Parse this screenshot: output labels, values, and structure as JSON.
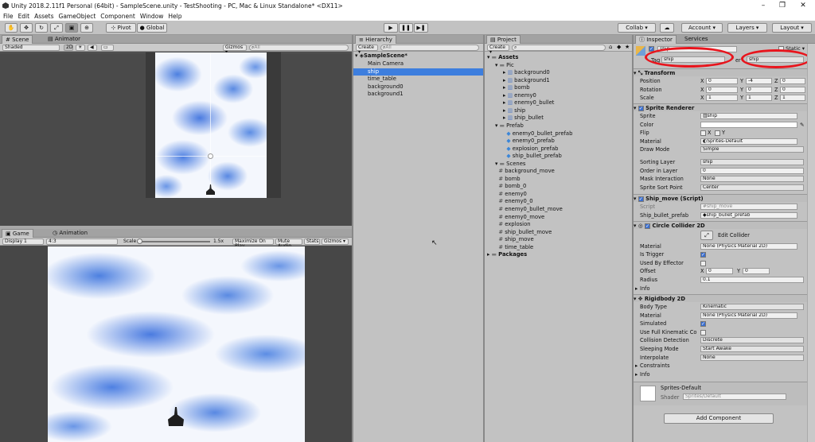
{
  "window": {
    "title": "Unity 2018.2.11f1 Personal (64bit) - SampleScene.unity - TestShooting - PC, Mac & Linux Standalone* <DX11>"
  },
  "menu": [
    "File",
    "Edit",
    "Assets",
    "GameObject",
    "Component",
    "Window",
    "Help"
  ],
  "toolbar": {
    "pivot": "Pivot",
    "global": "Global",
    "collab": "Collab ▾",
    "account": "Account ▾",
    "layers": "Layers ▾",
    "layout": "Layout ▾"
  },
  "scene": {
    "tab_scene": "Scene",
    "tab_animator": "Animator",
    "shading": "Shaded",
    "mode2d": "2D",
    "gizmos": "Gizmos ▾",
    "search": "All"
  },
  "game": {
    "tab_game": "Game",
    "tab_animation": "Animation",
    "display": "Display 1",
    "aspect": "4:3",
    "scale_label": "Scale",
    "scale_value": "1.5x",
    "maximize": "Maximize On Play",
    "mute": "Mute Audio",
    "stats": "Stats",
    "gizmos": "Gizmos ▾"
  },
  "hierarchy": {
    "tab": "Hierarchy",
    "create": "Create ▾",
    "search": "All",
    "scene": "SampleScene*",
    "items": [
      "Main Camera",
      "ship",
      "time_table",
      "background0",
      "background1"
    ]
  },
  "project": {
    "tab": "Project",
    "create": "Create ▾",
    "tree": [
      {
        "label": "Assets",
        "indent": 0,
        "kind": "folder"
      },
      {
        "label": "Pic",
        "indent": 1,
        "kind": "folder"
      },
      {
        "label": "background0",
        "indent": 2,
        "kind": "sprite"
      },
      {
        "label": "background1",
        "indent": 2,
        "kind": "sprite"
      },
      {
        "label": "bomb",
        "indent": 2,
        "kind": "sprite"
      },
      {
        "label": "enemy0",
        "indent": 2,
        "kind": "sprite"
      },
      {
        "label": "enemy0_bullet",
        "indent": 2,
        "kind": "sprite"
      },
      {
        "label": "ship",
        "indent": 2,
        "kind": "sprite"
      },
      {
        "label": "ship_bullet",
        "indent": 2,
        "kind": "sprite"
      },
      {
        "label": "Prefab",
        "indent": 1,
        "kind": "folder"
      },
      {
        "label": "enemy0_bullet_prefab",
        "indent": 2,
        "kind": "prefab"
      },
      {
        "label": "enemy0_prefab",
        "indent": 2,
        "kind": "prefab"
      },
      {
        "label": "explosion_prefab",
        "indent": 2,
        "kind": "prefab"
      },
      {
        "label": "ship_bullet_prefab",
        "indent": 2,
        "kind": "prefab"
      },
      {
        "label": "Scenes",
        "indent": 1,
        "kind": "folder"
      },
      {
        "label": "background_move",
        "indent": 1,
        "kind": "script"
      },
      {
        "label": "bomb",
        "indent": 1,
        "kind": "script"
      },
      {
        "label": "bomb_0",
        "indent": 1,
        "kind": "script"
      },
      {
        "label": "enemy0",
        "indent": 1,
        "kind": "script"
      },
      {
        "label": "enemy0_0",
        "indent": 1,
        "kind": "script"
      },
      {
        "label": "enemy0_bullet_move",
        "indent": 1,
        "kind": "script"
      },
      {
        "label": "enemy0_move",
        "indent": 1,
        "kind": "script"
      },
      {
        "label": "explosion",
        "indent": 1,
        "kind": "script"
      },
      {
        "label": "ship_bullet_move",
        "indent": 1,
        "kind": "script"
      },
      {
        "label": "ship_move",
        "indent": 1,
        "kind": "script"
      },
      {
        "label": "time_table",
        "indent": 1,
        "kind": "script"
      },
      {
        "label": "Packages",
        "indent": 0,
        "kind": "folder"
      }
    ]
  },
  "inspector": {
    "tab_inspector": "Inspector",
    "tab_services": "Services",
    "object_name": "ship",
    "static": "Static ▾",
    "tag_label": "Tag",
    "tag_value": "ship",
    "layer_label": "er",
    "layer_value": "ship",
    "transform": {
      "title": "Transform",
      "position_label": "Position",
      "rotation_label": "Rotation",
      "scale_label": "Scale",
      "position": {
        "x": "0",
        "y": "-4",
        "z": "0"
      },
      "rotation": {
        "x": "0",
        "y": "0",
        "z": "0"
      },
      "scale": {
        "x": "1",
        "y": "1",
        "z": "1"
      }
    },
    "sprite_renderer": {
      "title": "Sprite Renderer",
      "sprite_label": "Sprite",
      "sprite": "ship",
      "color_label": "Color",
      "flip_label": "Flip",
      "flip_x": "X",
      "flip_y": "Y",
      "material_label": "Material",
      "material": "Sprites-Default",
      "draw_mode_label": "Draw Mode",
      "draw_mode": "Simple",
      "sorting_layer_label": "Sorting Layer",
      "sorting_layer": "ship",
      "order_label": "Order in Layer",
      "order": "0",
      "mask_label": "Mask Interaction",
      "mask": "None",
      "sort_point_label": "Sprite Sort Point",
      "sort_point": "Center"
    },
    "ship_move": {
      "title": "Ship_move (Script)",
      "script_label": "Script",
      "script": "ship_move",
      "bullet_label": "Ship_bullet_prefab",
      "bullet": "ship_bullet_prefab"
    },
    "circle_collider": {
      "title": "Circle Collider 2D",
      "edit": "Edit Collider",
      "material_label": "Material",
      "material": "None (Physics Material 2D)",
      "trigger_label": "Is Trigger",
      "effector_label": "Used By Effector",
      "offset_label": "Offset",
      "offset_x": "0",
      "offset_y": "0",
      "radius_label": "Radius",
      "radius": "0.1",
      "info": "Info"
    },
    "rigidbody": {
      "title": "Rigidbody 2D",
      "body_type_label": "Body Type",
      "body_type": "Kinematic",
      "material_label": "Material",
      "material": "None (Physics Material 2D)",
      "simulated_label": "Simulated",
      "kinematic_label": "Use Full Kinematic Co",
      "collision_label": "Collision Detection",
      "collision": "Discrete",
      "sleeping_label": "Sleeping Mode",
      "sleeping": "Start Awake",
      "interpolate_label": "Interpolate",
      "interpolate": "None",
      "constraints": "Constraints",
      "info": "Info"
    },
    "material_preview": {
      "name": "Sprites-Default",
      "shader_label": "Shader",
      "shader": "Sprites/Default"
    },
    "add_component": "Add Component"
  },
  "colors": {
    "selection": "#3d7ede",
    "annotation": "#e8141c"
  }
}
